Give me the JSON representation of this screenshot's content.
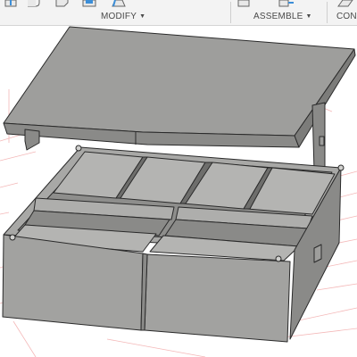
{
  "toolbar": {
    "groups": [
      {
        "label": "MODIFY",
        "has_dropdown": true,
        "icons": [
          "push-pull-icon",
          "fillet-icon",
          "chamfer-icon",
          "shell-icon",
          "draft-icon"
        ]
      },
      {
        "label": "ASSEMBLE",
        "has_dropdown": true,
        "icons": [
          "new-component-icon",
          "joint-icon"
        ]
      },
      {
        "label": "CONS",
        "has_dropdown": false,
        "icons": [
          "offset-plane-icon"
        ]
      }
    ],
    "dropdown_caret": "▼"
  },
  "viewport": {
    "background": "#ffffff",
    "grid_color": "#f4b8b8",
    "model_color": "#9e9e9c",
    "model_shadow": "#7c7c7a",
    "edge_color": "#2a2a2a",
    "model": {
      "name": "storage-box-with-lid",
      "compartments_top_row": 4,
      "compartments_bottom_row": 2
    }
  },
  "colors": {
    "toolbar_bg": "#f3f3f3",
    "accent_blue": "#3b8ed8"
  }
}
